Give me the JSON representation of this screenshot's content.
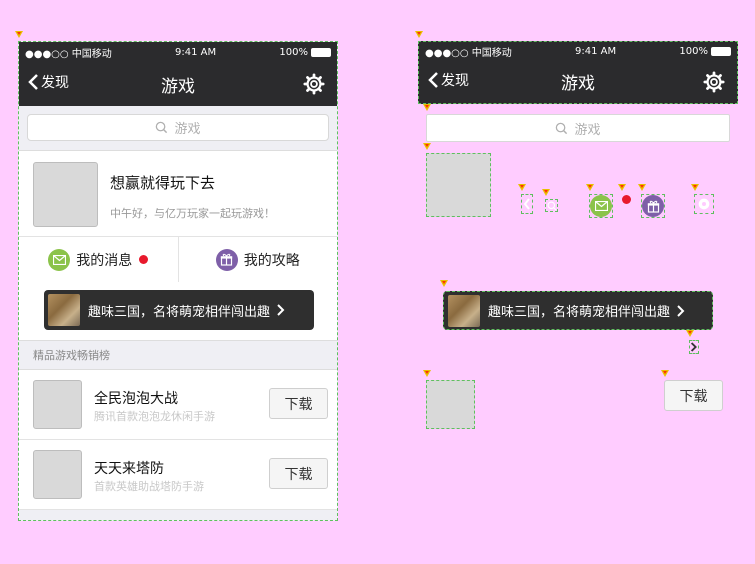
{
  "status": {
    "carrier": "●●●○○ 中国移动",
    "time": "9:41 AM",
    "battery": "100%"
  },
  "nav": {
    "back_label": "发现",
    "title": "游戏"
  },
  "search": {
    "placeholder": "游戏"
  },
  "profile": {
    "title": "想赢就得玩下去",
    "subtitle": "中午好，与亿万玩家一起玩游戏！"
  },
  "tabs": [
    {
      "label": "我的消息",
      "icon": "mail-icon"
    },
    {
      "label": "我的攻略",
      "icon": "gift-icon"
    }
  ],
  "banner": {
    "text": "趣味三国，名将萌宠相伴闯出趣"
  },
  "section": {
    "title": "精品游戏畅销榜"
  },
  "games": [
    {
      "name": "全民泡泡大战",
      "desc": "腾讯首款泡泡龙休闲手游",
      "action": "下载"
    },
    {
      "name": "天天来塔防",
      "desc": "首款英雄助战塔防手游",
      "action": "下载"
    }
  ],
  "assets": {
    "download_label": "下载"
  },
  "colors": {
    "dark_bar": "#2b2b2d",
    "mail_green": "#8bc34a",
    "gift_purple": "#7e5fa8",
    "badge_red": "#e8192c",
    "background": "#ffccff"
  }
}
